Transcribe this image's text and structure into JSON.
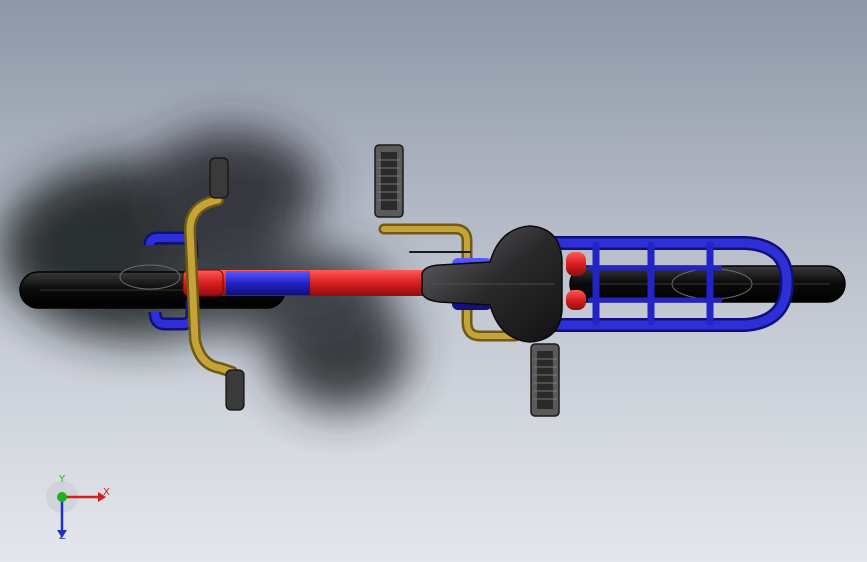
{
  "viewport": {
    "background_top": "#8e97a8",
    "background_bottom": "#e4e7ec",
    "shadow_color": "#1e1f22"
  },
  "model": {
    "parts": [
      {
        "id": "front-wheel",
        "color": "#0f0f10"
      },
      {
        "id": "rear-wheel",
        "color": "#0f0f10"
      },
      {
        "id": "main-frame-tube",
        "color": "#d81e1e"
      },
      {
        "id": "fork",
        "color": "#2828cc"
      },
      {
        "id": "handlebar",
        "color": "#b89a2c"
      },
      {
        "id": "grips",
        "color": "#3a3a3a"
      },
      {
        "id": "saddle",
        "color": "#2a2a2c"
      },
      {
        "id": "seat-post-bracket",
        "color": "#b89a2c"
      },
      {
        "id": "rear-rack",
        "color": "#2323c8"
      },
      {
        "id": "pedals",
        "color": "#5a5a5a"
      }
    ]
  },
  "triad": {
    "x_label": "X",
    "y_label": "Y",
    "z_label": "Z",
    "x_color": "#d02020",
    "y_color": "#20b020",
    "z_color": "#2030c0"
  }
}
